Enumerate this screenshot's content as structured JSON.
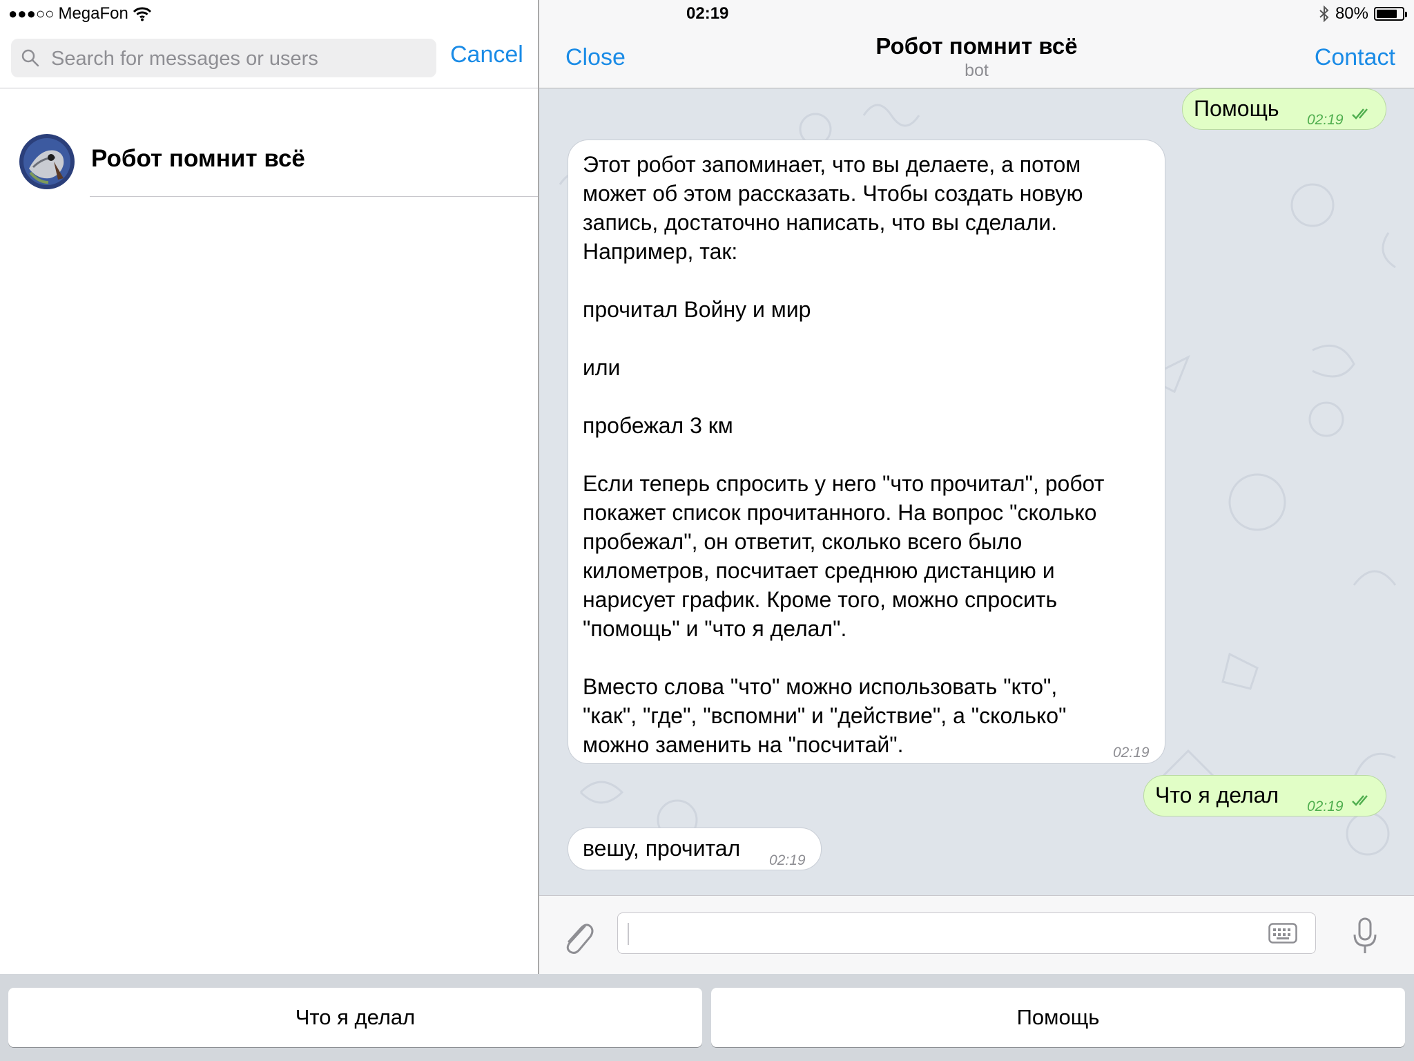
{
  "status_bar": {
    "signal": "●●●○○",
    "carrier": "MegaFon",
    "time": "02:19",
    "battery_text": "80%",
    "battery_level": 0.8
  },
  "search": {
    "placeholder": "Search for messages or users",
    "value": "",
    "cancel_label": "Cancel"
  },
  "results": [
    {
      "name": "Робот помнит всё"
    }
  ],
  "chat": {
    "close_label": "Close",
    "contact_label": "Contact",
    "title": "Робот помнит всё",
    "subtitle": "bot"
  },
  "messages": [
    {
      "direction": "out",
      "text": "Помощь",
      "time": "02:19",
      "read": true
    },
    {
      "direction": "in",
      "text": "Этот робот запоминает, что вы делаете, а потом\nможет об этом рассказать. Чтобы создать новую\nзапись, достаточно написать, что вы сделали.\nНапример, так:\n\nпрочитал Войну и мир\n\nили\n\nпробежал 3 км\n\nЕсли теперь спросить у него \"что прочитал\", робот\nпокажет список прочитанного. На вопрос \"сколько\nпробежал\", он ответит, сколько всего было\nкилометров, посчитает среднюю дистанцию и\nнарисует график. Кроме того, можно спросить\n\"помощь\" и \"что я делал\".\n\nВместо слова \"что\" можно использовать \"кто\",\n\"как\", \"где\", \"вспомни\" и \"действие\", а \"сколько\"\nможно заменить на \"посчитай\".",
      "time": "02:19"
    },
    {
      "direction": "out",
      "text": "Что я делал",
      "time": "02:19",
      "read": true
    },
    {
      "direction": "in",
      "text": "вешу, прочитал",
      "time": "02:19"
    }
  ],
  "composer": {
    "value": ""
  },
  "keyboard_buttons": [
    {
      "label": "Что я делал"
    },
    {
      "label": "Помощь"
    }
  ],
  "icons": {
    "search": "search-icon",
    "wifi": "wifi-icon",
    "bluetooth": "bluetooth-icon",
    "battery": "battery-icon",
    "attach": "paperclip-icon",
    "keyboard": "keyboard-icon",
    "mic": "microphone-icon"
  },
  "colors": {
    "accent": "#1a8be6",
    "outgoing_bubble": "#e1fec6",
    "incoming_bubble": "#ffffff",
    "chat_background": "#dfe4ea",
    "read_ticks": "#4fae4e"
  }
}
